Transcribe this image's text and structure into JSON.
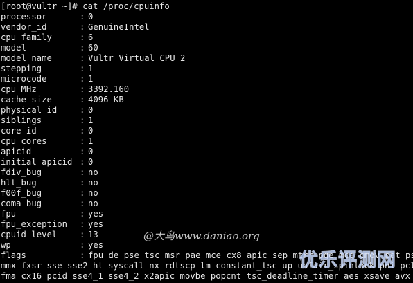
{
  "terminal": {
    "prompt": "[root@vultr ~]# cat /proc/cpuinfo",
    "fields": [
      {
        "key": "processor",
        "value": "0"
      },
      {
        "key": "vendor_id",
        "value": "GenuineIntel"
      },
      {
        "key": "cpu family",
        "value": "6"
      },
      {
        "key": "model",
        "value": "60"
      },
      {
        "key": "model name",
        "value": "Vultr Virtual CPU 2"
      },
      {
        "key": "stepping",
        "value": "1"
      },
      {
        "key": "microcode",
        "value": "1"
      },
      {
        "key": "cpu MHz",
        "value": "3392.160"
      },
      {
        "key": "cache size",
        "value": "4096 KB"
      },
      {
        "key": "physical id",
        "value": "0"
      },
      {
        "key": "siblings",
        "value": "1"
      },
      {
        "key": "core id",
        "value": "0"
      },
      {
        "key": "cpu cores",
        "value": "1"
      },
      {
        "key": "apicid",
        "value": "0"
      },
      {
        "key": "initial apicid",
        "value": "0"
      },
      {
        "key": "fdiv_bug",
        "value": "no"
      },
      {
        "key": "hlt_bug",
        "value": "no"
      },
      {
        "key": "f00f_bug",
        "value": "no"
      },
      {
        "key": "coma_bug",
        "value": "no"
      },
      {
        "key": "fpu",
        "value": "yes"
      },
      {
        "key": "fpu_exception",
        "value": "yes"
      },
      {
        "key": "cpuid level",
        "value": "13"
      },
      {
        "key": "wp",
        "value": "yes"
      },
      {
        "key": "flags",
        "value": "fpu de pse tsc msr pae mce cx8 apic sep mtrr pge mca cmov pat pse36"
      }
    ],
    "separator": ":",
    "wrapped_lines": [
      "mmx fxsr sse sse2 ht syscall nx rdtscp lm constant_tsc up unfair_spinlock pni pclmulq",
      "fma cx16 pcid sse4_1 sse4_2 x2apic movbe popcnt tsc_deadline_timer aes xsave avx hype"
    ]
  },
  "watermark": {
    "text": "@大鸟www.daniao.org",
    "logo_text": "优乐评测网",
    "logo_color": "#2a6ee6"
  },
  "colors": {
    "background": "#000000",
    "foreground": "#e6e6e6"
  }
}
